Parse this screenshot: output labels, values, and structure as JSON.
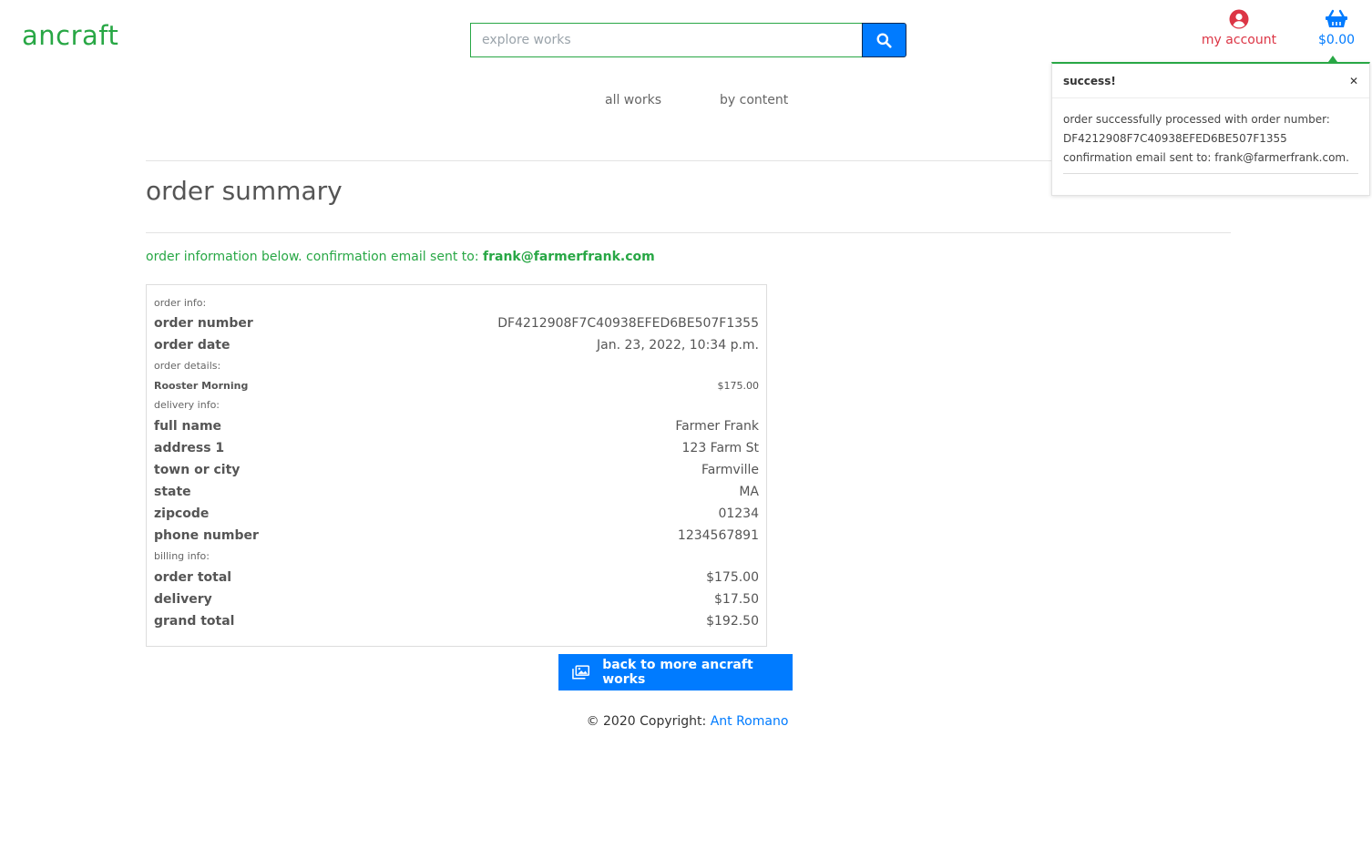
{
  "header": {
    "logo": "ancraft",
    "search_placeholder": "explore works",
    "account_label": "my account",
    "cart_total": "$0.00"
  },
  "nav": {
    "items": [
      "all works",
      "by content"
    ]
  },
  "page": {
    "title": "order summary",
    "confirmation_prefix": "order information below. confirmation email sent to:",
    "confirmation_email": "frank@farmerfrank.com"
  },
  "summary": {
    "order_info_label": "order info:",
    "order_number_label": "order number",
    "order_number": "DF4212908F7C40938EFED6BE507F1355",
    "order_date_label": "order date",
    "order_date": "Jan. 23, 2022, 10:34 p.m.",
    "order_details_label": "order details:",
    "item_name": "Rooster Morning",
    "item_price": "$175.00",
    "delivery_info_label": "delivery info:",
    "full_name_label": "full name",
    "full_name": "Farmer Frank",
    "address1_label": "address 1",
    "address1": "123 Farm St",
    "town_label": "town or city",
    "town": "Farmville",
    "state_label": "state",
    "state": "MA",
    "zipcode_label": "zipcode",
    "zipcode": "01234",
    "phone_label": "phone number",
    "phone": "1234567891",
    "billing_info_label": "billing info:",
    "order_total_label": "order total",
    "order_total": "$175.00",
    "delivery_label": "delivery",
    "delivery": "$17.50",
    "grand_total_label": "grand total",
    "grand_total": "$192.50"
  },
  "actions": {
    "back_label": "back to more ancraft works"
  },
  "footer": {
    "copyright": "© 2020 Copyright:",
    "author": "Ant Romano"
  },
  "toast": {
    "title": "success!",
    "line1": "order successfully processed with order number:",
    "line2": "DF4212908F7C40938EFED6BE507F1355",
    "line3": "confirmation email sent to: frank@farmerfrank.com."
  },
  "colors": {
    "brand_green": "#28a745",
    "primary_blue": "#007bff",
    "account_red": "#dc3545"
  },
  "icons": [
    "search-icon",
    "user-circle-icon",
    "shopping-basket-icon",
    "images-icon",
    "close-icon"
  ]
}
